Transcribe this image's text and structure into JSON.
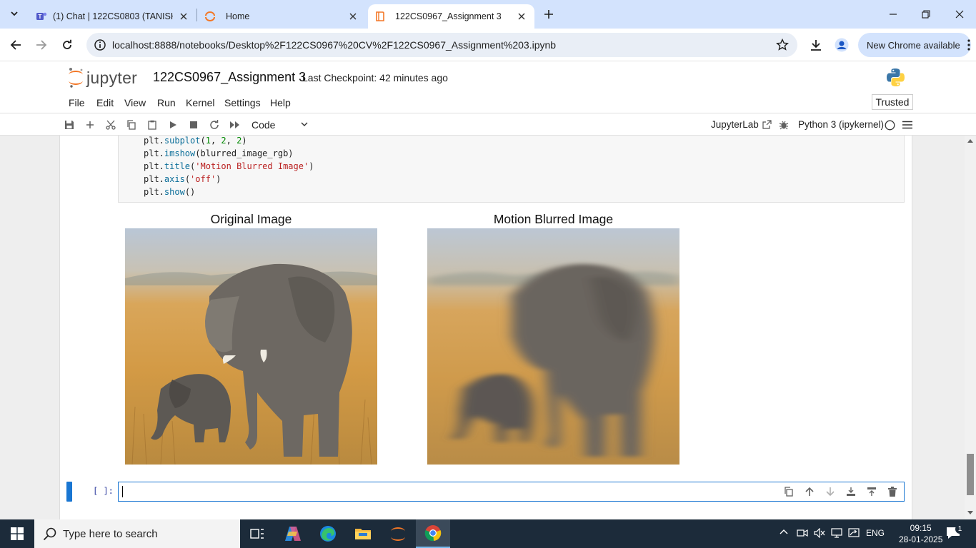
{
  "browser": {
    "tabs": [
      {
        "title": "(1) Chat | 122CS0803 (TANISHK"
      },
      {
        "title": "Home"
      },
      {
        "title": "122CS0967_Assignment 3"
      }
    ],
    "url": "localhost:8888/notebooks/Desktop%2F122CS0967%20CV%2F122CS0967_Assignment%203.ipynb",
    "update_label": "New Chrome available"
  },
  "jupyter": {
    "logo_text": "jupyter",
    "notebook_title": "122CS0967_Assignment 3",
    "checkpoint": "Last Checkpoint: 42 minutes ago",
    "menu": [
      "File",
      "Edit",
      "View",
      "Run",
      "Kernel",
      "Settings",
      "Help"
    ],
    "trusted": "Trusted",
    "cell_type": "Code",
    "jupyterlab_label": "JupyterLab",
    "kernel_name": "Python 3 (ipykernel)"
  },
  "code": {
    "lines": [
      "plt.subplot(1, 2, 2)",
      "plt.imshow(blurred_image_rgb)",
      "plt.title('Motion Blurred Image')",
      "plt.axis('off')",
      "plt.show()"
    ]
  },
  "output": {
    "left_title": "Original Image",
    "right_title": "Motion Blurred Image"
  },
  "empty_cell": {
    "prompt": "[ ]:"
  },
  "taskbar": {
    "search_placeholder": "Type here to search",
    "language": "ENG",
    "time": "09:15",
    "date": "28-01-2025",
    "notification_count": "1"
  }
}
